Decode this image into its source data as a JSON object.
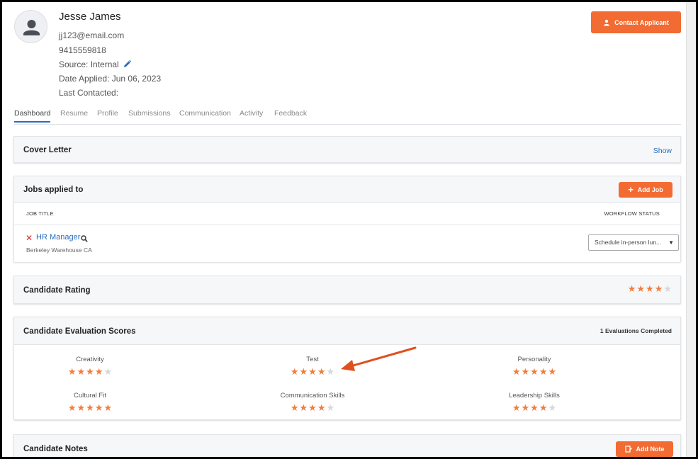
{
  "applicant": {
    "name": "Jesse James",
    "email": "jj123@email.com",
    "phone": "9415559818",
    "source": "Source: Internal",
    "date_applied": "Date Applied: Jun 06, 2023",
    "last_contacted": "Last Contacted:"
  },
  "contact_button": {
    "label": "Contact Applicant",
    "icon": "user-icon"
  },
  "tabs": [
    {
      "label": "Dashboard",
      "active": true
    },
    {
      "label": "Resume"
    },
    {
      "label": "Profile"
    },
    {
      "label": "Submissions"
    },
    {
      "label": "Communication"
    },
    {
      "label": "Activity"
    },
    {
      "label": "Feedback"
    }
  ],
  "cover_letter": {
    "title": "Cover Letter",
    "action": "Show"
  },
  "jobs": {
    "title": "Jobs applied to",
    "add_label": "Add Job",
    "columns": [
      "JOB TITLE",
      "WORKFLOW STATUS"
    ],
    "rows": [
      {
        "title": "HR Manager",
        "location": "Berkeley Warehouse CA",
        "status": "Schedule in-person lun..."
      }
    ]
  },
  "rating": {
    "title": "Candidate Rating",
    "stars": 4,
    "max": 5
  },
  "evaluation": {
    "title": "Candidate Evaluation Scores",
    "summary": "1 Evaluations Completed",
    "scores": [
      {
        "label": "Creativity",
        "stars": 4
      },
      {
        "label": "Test",
        "stars": 4
      },
      {
        "label": "Personality",
        "stars": 5
      },
      {
        "label": "Cultural Fit",
        "stars": 5
      },
      {
        "label": "Communication Skills",
        "stars": 4
      },
      {
        "label": "Leadership Skills",
        "stars": 4
      }
    ]
  },
  "notes": {
    "title": "Candidate Notes",
    "add_label": "Add Note"
  },
  "colors": {
    "accent": "#f26b33",
    "link": "#2a6ebb",
    "star_on": "#f27d3a",
    "star_off": "#d7d7d7",
    "remove": "#d9252a"
  }
}
